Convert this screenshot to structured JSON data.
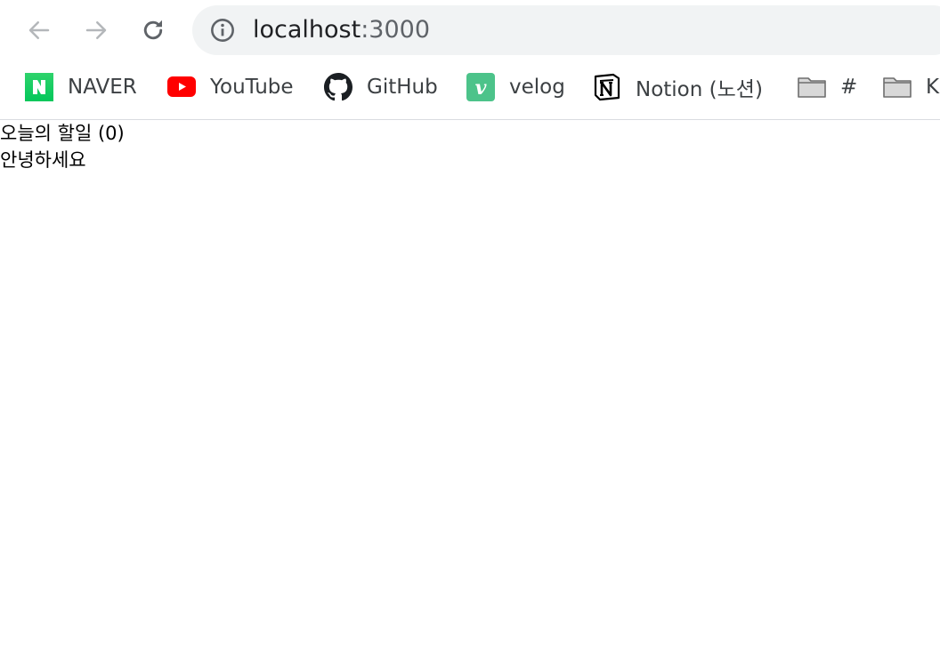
{
  "toolbar": {
    "back_icon": "arrow-left-icon",
    "forward_icon": "arrow-right-icon",
    "reload_icon": "reload-icon"
  },
  "address_bar": {
    "host": "localhost",
    "port": ":3000",
    "icon": "info-icon"
  },
  "bookmarks": [
    {
      "label": "NAVER",
      "icon": "naver-icon",
      "color": "#03c75a"
    },
    {
      "label": "YouTube",
      "icon": "youtube-icon",
      "color": "#ff0000"
    },
    {
      "label": "GitHub",
      "icon": "github-icon",
      "color": "#1b1f23"
    },
    {
      "label": "velog",
      "icon": "velog-icon",
      "color": "#20c997"
    },
    {
      "label": "Notion (노션)",
      "icon": "notion-icon",
      "color": "#000000"
    },
    {
      "label": "#",
      "icon": "folder-icon",
      "color": "#8a8a8a"
    },
    {
      "label": "K",
      "icon": "folder-icon",
      "color": "#8a8a8a"
    }
  ],
  "page": {
    "heading": "오늘의 할일 (0)",
    "message": "안녕하세요"
  }
}
